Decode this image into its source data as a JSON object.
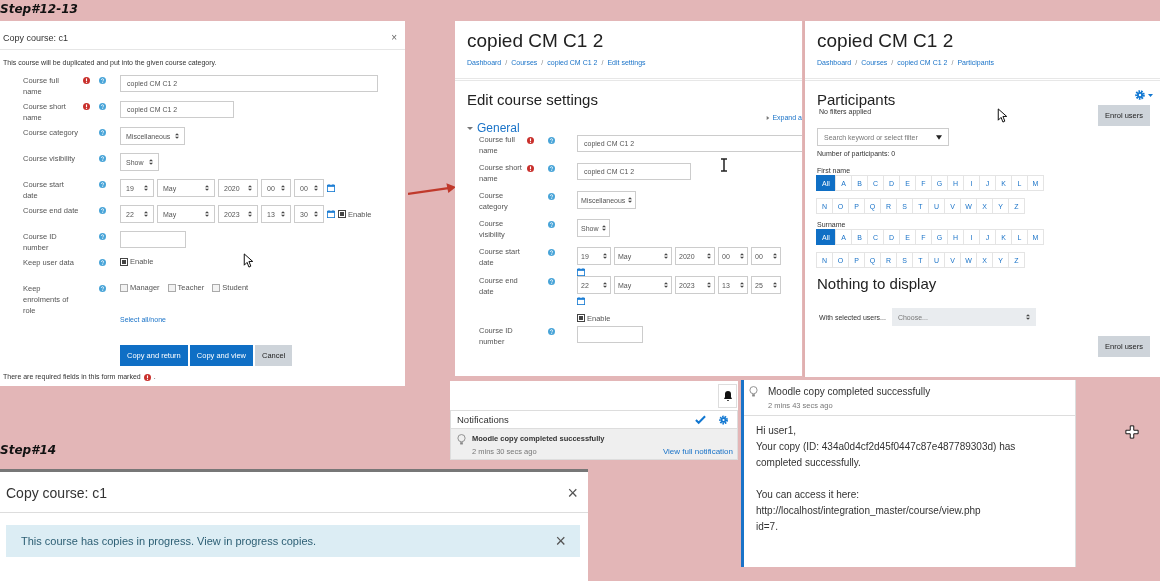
{
  "captions": [
    {
      "text": "Step#12-13"
    },
    {
      "text": "Step#14"
    }
  ],
  "copy_dialog": {
    "title": "Copy course: c1",
    "close": "×",
    "intro": "This course will be duplicated and put into the given course category.",
    "fields": [
      {
        "label": "Course full name",
        "required": true,
        "kind": "text",
        "value": "copied CM C1 2"
      },
      {
        "label": "Course short name",
        "required": true,
        "kind": "text",
        "value": "copied CM C1 2"
      },
      {
        "label": "Course category",
        "required": false,
        "kind": "select",
        "value": "Miscellaneous"
      },
      {
        "label": "Course visibility",
        "required": false,
        "kind": "select",
        "value": "Show"
      },
      {
        "label": "Course start date",
        "required": false,
        "kind": "date",
        "parts": [
          "19",
          "May",
          "2020",
          "00",
          "00"
        ]
      },
      {
        "label": "Course end date",
        "required": false,
        "kind": "date",
        "parts": [
          "22",
          "May",
          "2023",
          "13",
          "30"
        ],
        "enable": {
          "label": "Enable",
          "checked": true
        }
      },
      {
        "label": "Course ID number",
        "required": false,
        "kind": "text"
      },
      {
        "label": "Keep user data",
        "required": false,
        "kind": "checkbox",
        "options": [
          {
            "label": "Enable",
            "checked": true
          }
        ]
      },
      {
        "label": "Keep enrolments of role",
        "required": false,
        "kind": "checkbox",
        "options": [
          {
            "label": "Manager",
            "checked": false
          },
          {
            "label": "Teacher",
            "checked": false
          },
          {
            "label": "Student",
            "checked": false
          }
        ]
      }
    ],
    "select_all": "Select all/none",
    "buttons": [
      {
        "label": "Copy and return",
        "kind": "primary"
      },
      {
        "label": "Copy and view",
        "kind": "primary"
      },
      {
        "label": "Cancel",
        "kind": "secondary"
      }
    ],
    "footer": "There are required fields in this form marked",
    "footer_end": "."
  },
  "edit_settings": {
    "heading": "copied CM C1 2",
    "breadcrumbs": [
      "Dashboard",
      "Courses",
      "copied CM C1 2",
      "Edit settings"
    ],
    "breadcrumb_separator": "/",
    "title": "Edit course settings",
    "expand_link": "Expand a",
    "section": "General",
    "section_expanded": true,
    "fields": [
      {
        "label": "Course full name",
        "required": true,
        "kind": "text",
        "value": "copied CM C1 2"
      },
      {
        "label": "Course short name",
        "required": true,
        "kind": "text",
        "value": "copied CM C1 2"
      },
      {
        "label": "Course category",
        "required": false,
        "kind": "select",
        "value": "Miscellaneous"
      },
      {
        "label": "Course visibility",
        "required": false,
        "kind": "select",
        "value": "Show"
      },
      {
        "label": "Course start date",
        "required": false,
        "kind": "date",
        "parts": [
          "19",
          "May",
          "2020",
          "00",
          "00"
        ]
      },
      {
        "label": "Course end date",
        "required": false,
        "kind": "date",
        "parts": [
          "22",
          "May",
          "2023",
          "13",
          "25"
        ],
        "enable": {
          "label": "Enable",
          "checked": true
        }
      },
      {
        "label": "Course ID number",
        "required": false,
        "kind": "text"
      }
    ]
  },
  "participants": {
    "heading": "copied CM C1 2",
    "breadcrumbs": [
      "Dashboard",
      "Courses",
      "copied CM C1 2",
      "Participants"
    ],
    "breadcrumb_separator": "/",
    "title": "Participants",
    "filter_status": "No filters applied",
    "enrol_button": "Enrol users",
    "search": {
      "placeholder": "Search keyword or select filter"
    },
    "count": "Number of participants: 0",
    "initial_bars": [
      {
        "label": "First name",
        "rows": [
          [
            {
              "label": "All",
              "selected": true
            },
            {
              "label": "A",
              "selected": false
            },
            {
              "label": "B",
              "selected": false
            },
            {
              "label": "C",
              "selected": false
            },
            {
              "label": "D",
              "selected": false
            },
            {
              "label": "E",
              "selected": false
            },
            {
              "label": "F",
              "selected": false
            },
            {
              "label": "G",
              "selected": false
            },
            {
              "label": "H",
              "selected": false
            },
            {
              "label": "I",
              "selected": false
            },
            {
              "label": "J",
              "selected": false
            },
            {
              "label": "K",
              "selected": false
            },
            {
              "label": "L",
              "selected": false
            },
            {
              "label": "M",
              "selected": false
            }
          ],
          [
            {
              "label": "N",
              "selected": false
            },
            {
              "label": "O",
              "selected": false
            },
            {
              "label": "P",
              "selected": false
            },
            {
              "label": "Q",
              "selected": false
            },
            {
              "label": "R",
              "selected": false
            },
            {
              "label": "S",
              "selected": false
            },
            {
              "label": "T",
              "selected": false
            },
            {
              "label": "U",
              "selected": false
            },
            {
              "label": "V",
              "selected": false
            },
            {
              "label": "W",
              "selected": false
            },
            {
              "label": "X",
              "selected": false
            },
            {
              "label": "Y",
              "selected": false
            },
            {
              "label": "Z",
              "selected": false
            }
          ]
        ]
      },
      {
        "label": "Surname",
        "rows": [
          [
            {
              "label": "All",
              "selected": true
            },
            {
              "label": "A",
              "selected": false
            },
            {
              "label": "B",
              "selected": false
            },
            {
              "label": "C",
              "selected": false
            },
            {
              "label": "D",
              "selected": false
            },
            {
              "label": "E",
              "selected": false
            },
            {
              "label": "F",
              "selected": false
            },
            {
              "label": "G",
              "selected": false
            },
            {
              "label": "H",
              "selected": false
            },
            {
              "label": "I",
              "selected": false
            },
            {
              "label": "J",
              "selected": false
            },
            {
              "label": "K",
              "selected": false
            },
            {
              "label": "L",
              "selected": false
            },
            {
              "label": "M",
              "selected": false
            }
          ],
          [
            {
              "label": "N",
              "selected": false
            },
            {
              "label": "O",
              "selected": false
            },
            {
              "label": "P",
              "selected": false
            },
            {
              "label": "Q",
              "selected": false
            },
            {
              "label": "R",
              "selected": false
            },
            {
              "label": "S",
              "selected": false
            },
            {
              "label": "T",
              "selected": false
            },
            {
              "label": "U",
              "selected": false
            },
            {
              "label": "V",
              "selected": false
            },
            {
              "label": "W",
              "selected": false
            },
            {
              "label": "X",
              "selected": false
            },
            {
              "label": "Y",
              "selected": false
            },
            {
              "label": "Z",
              "selected": false
            }
          ]
        ]
      }
    ],
    "empty": "Nothing to display",
    "with_selected": "With selected users...",
    "choose": {
      "placeholder": "Choose..."
    },
    "enrol_button_bottom": "Enrol users"
  },
  "notifications": {
    "title": "Notifications",
    "item": {
      "title": "Moodle copy completed successfully",
      "time": "2 mins 30 secs ago"
    },
    "link": "View full notification"
  },
  "notification_detail": {
    "title": "Moodle copy completed successfully",
    "time": "2 mins 43 secs ago",
    "paragraphs": [
      [
        "Hi user1,",
        "Your copy (ID: 434a0d4cf2d45f0447c87e487789303d) has completed successfully."
      ],
      [
        "You can access it here:",
        "http://localhost/integration_master/course/view.php",
        "id=7."
      ]
    ]
  },
  "progress_dialog": {
    "title": "Copy course: c1",
    "close": "×",
    "alert": "This course has copies in progress. View in progress copies.",
    "alert_close": "×"
  }
}
